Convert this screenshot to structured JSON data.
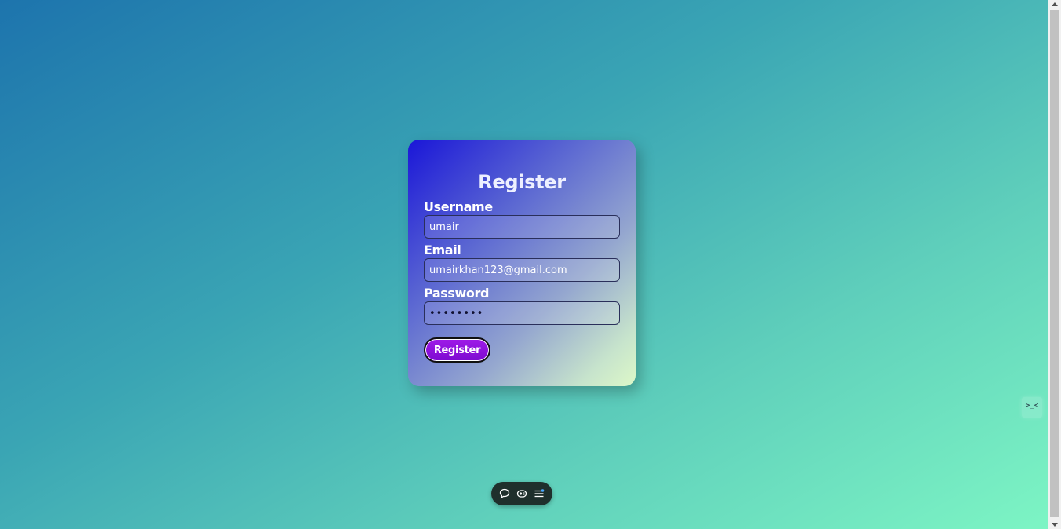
{
  "form": {
    "title": "Register",
    "username_label": "Username",
    "username_value": "umair",
    "email_label": "Email",
    "email_value": "umairkhan123@gmail.com",
    "password_label": "Password",
    "password_value": "********",
    "submit_label": "Register"
  },
  "side_widget": {
    "text": ">_<"
  },
  "toolbar": {
    "icons": [
      "comment-icon",
      "eye-toggle-icon",
      "menu-list-icon"
    ]
  },
  "colors": {
    "button_purple": "#8d12dc",
    "toolbar_bg": "#1f2f2c"
  }
}
